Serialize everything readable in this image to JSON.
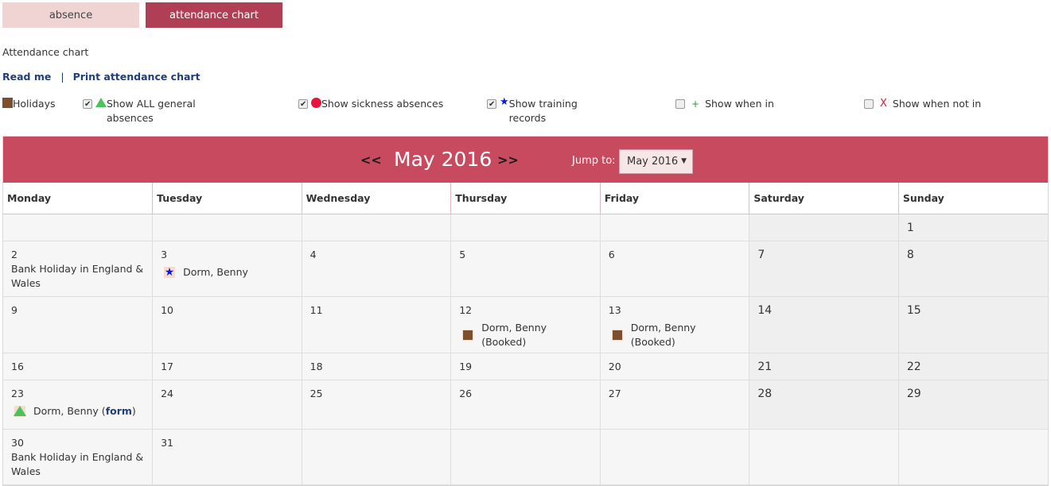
{
  "tabs": [
    {
      "label": "absence",
      "active": false
    },
    {
      "label": "attendance chart",
      "active": true
    }
  ],
  "page_title": "Attendance chart",
  "links": {
    "read_me": "Read me",
    "separator": "|",
    "print": "Print attendance chart"
  },
  "legend": {
    "holidays": "Holidays",
    "general": {
      "label": "Show ALL general absences",
      "checked": true
    },
    "sickness": {
      "label": "Show sickness absences",
      "checked": true
    },
    "training": {
      "label": "Show training records",
      "checked": true
    },
    "when_in": {
      "symbol": "+",
      "label": "Show when in",
      "checked": false
    },
    "when_not_in": {
      "symbol": "X",
      "label": "Show when not in",
      "checked": false
    }
  },
  "calendar": {
    "prev": "<<",
    "next": ">>",
    "month_title": "May 2016",
    "jump_label": "Jump to:",
    "jump_value": "May 2016",
    "weekdays": [
      "Monday",
      "Tuesday",
      "Wednesday",
      "Thursday",
      "Friday",
      "Saturday",
      "Sunday"
    ],
    "weeks": [
      [
        {
          "day": ""
        },
        {
          "day": ""
        },
        {
          "day": ""
        },
        {
          "day": ""
        },
        {
          "day": ""
        },
        {
          "day": ""
        },
        {
          "day": "1"
        }
      ],
      [
        {
          "day": "2",
          "note": "Bank Holiday in England & Wales"
        },
        {
          "day": "3",
          "event": {
            "icon": "star",
            "text": "Dorm, Benny"
          }
        },
        {
          "day": "4"
        },
        {
          "day": "5"
        },
        {
          "day": "6"
        },
        {
          "day": "7"
        },
        {
          "day": "8"
        }
      ],
      [
        {
          "day": "9"
        },
        {
          "day": "10"
        },
        {
          "day": "11"
        },
        {
          "day": "12",
          "event": {
            "icon": "square",
            "text": "Dorm, Benny (Booked)"
          }
        },
        {
          "day": "13",
          "event": {
            "icon": "square",
            "text": "Dorm, Benny (Booked)"
          }
        },
        {
          "day": "14"
        },
        {
          "day": "15"
        }
      ],
      [
        {
          "day": "16"
        },
        {
          "day": "17"
        },
        {
          "day": "18"
        },
        {
          "day": "19"
        },
        {
          "day": "20"
        },
        {
          "day": "21"
        },
        {
          "day": "22"
        }
      ],
      [
        {
          "day": "23",
          "event": {
            "icon": "triangle",
            "text": "Dorm, Benny (",
            "link": "form",
            "suffix": ")"
          }
        },
        {
          "day": "24"
        },
        {
          "day": "25"
        },
        {
          "day": "26"
        },
        {
          "day": "27"
        },
        {
          "day": "28"
        },
        {
          "day": "29"
        }
      ],
      [
        {
          "day": "30",
          "note": "Bank Holiday in England & Wales"
        },
        {
          "day": "31"
        },
        {
          "day": ""
        },
        {
          "day": ""
        },
        {
          "day": ""
        },
        {
          "day": ""
        },
        {
          "day": ""
        }
      ]
    ]
  }
}
